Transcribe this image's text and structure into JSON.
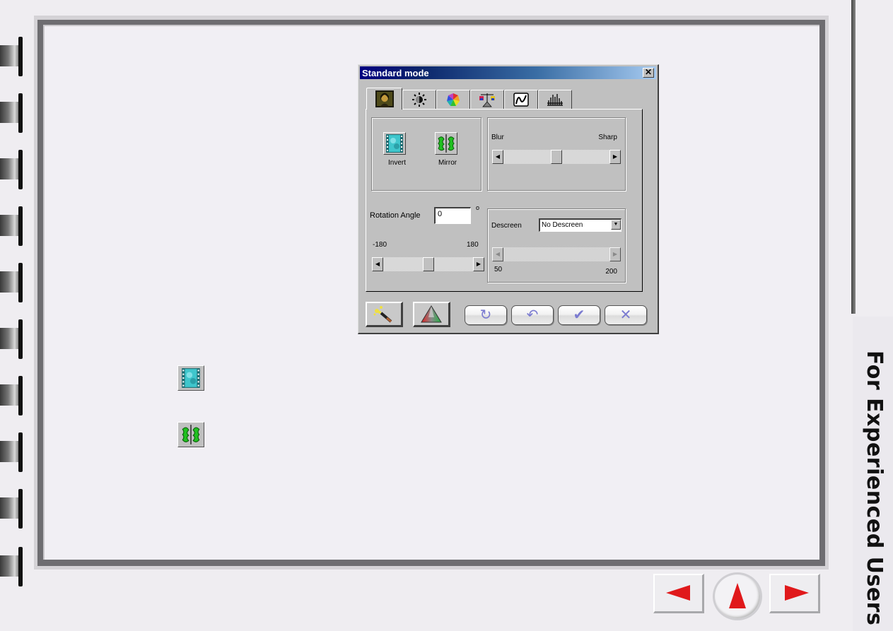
{
  "page": {
    "section_title": "For Experienced Users",
    "nav": {
      "prev_icon": "left-arrow-icon",
      "up_icon": "up-arrow-icon",
      "next_icon": "right-arrow-icon",
      "arrow_color": "#e0191b"
    }
  },
  "dialog": {
    "title": "Standard mode",
    "close_label": "✕",
    "tabs": [
      {
        "name": "image",
        "icon": "mona-lisa-icon",
        "active": true
      },
      {
        "name": "brightness",
        "icon": "sun-icon",
        "active": false
      },
      {
        "name": "color",
        "icon": "color-wheel-icon",
        "active": false
      },
      {
        "name": "balance",
        "icon": "balance-scale-icon",
        "active": false
      },
      {
        "name": "curve",
        "icon": "curve-icon",
        "active": false
      },
      {
        "name": "histogram",
        "icon": "histogram-icon",
        "active": false
      }
    ],
    "transform": {
      "invert_label": "Invert",
      "mirror_label": "Mirror"
    },
    "sharpness": {
      "min_label": "Blur",
      "max_label": "Sharp",
      "value_fraction": 0.5
    },
    "rotation": {
      "label": "Rotation Angle",
      "value": "0",
      "unit": "o",
      "min_label": "-180",
      "max_label": "180",
      "slider_fraction": 0.5
    },
    "descreen": {
      "label": "Descreen",
      "selected": "No Descreen",
      "min_label": "50",
      "max_label": "200",
      "enabled": false
    },
    "buttons": {
      "auto_icon": "magic-wand-icon",
      "color_icon": "color-triangle-icon",
      "reset_symbol": "↻",
      "undo_symbol": "↶",
      "ok_symbol": "✔",
      "cancel_symbol": "✕"
    }
  },
  "legend": {
    "invert_icon": "invert-icon",
    "mirror_icon": "mirror-icon"
  }
}
